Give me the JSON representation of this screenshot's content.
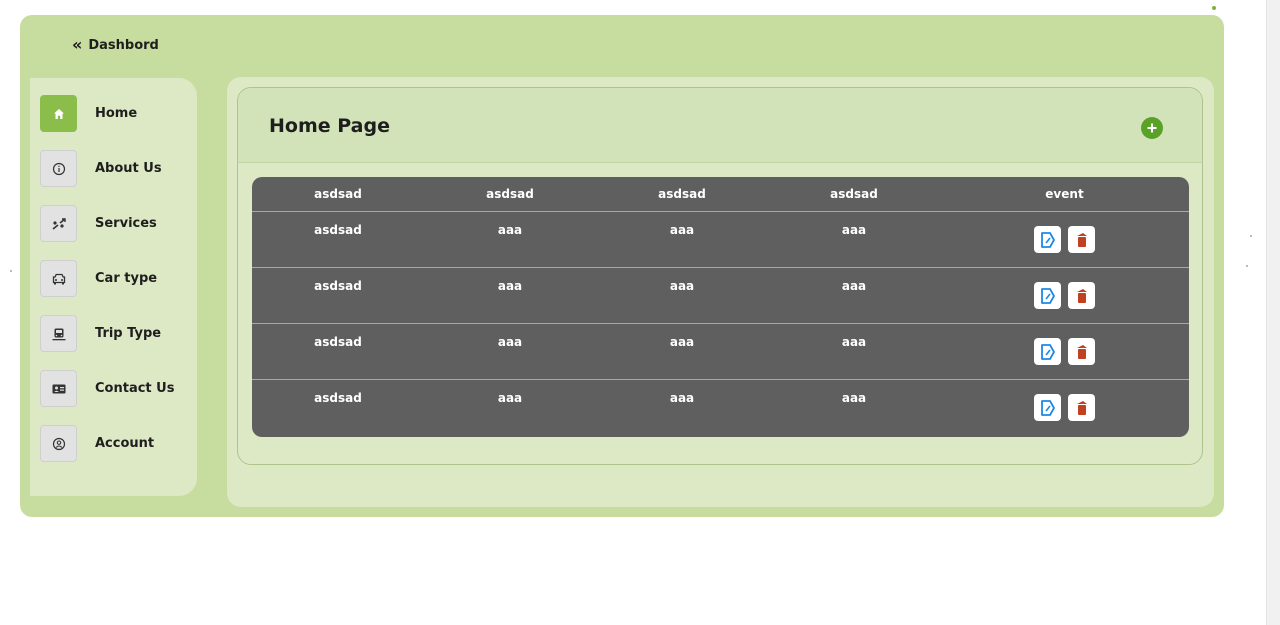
{
  "app": {
    "title": "Dashbord",
    "collapse_icon": "chevron-double-left-icon"
  },
  "sidebar": {
    "items": [
      {
        "label": "Home",
        "icon": "home-icon",
        "active": true
      },
      {
        "label": "About Us",
        "icon": "info-icon",
        "active": false
      },
      {
        "label": "Services",
        "icon": "services-icon",
        "active": false
      },
      {
        "label": "Car type",
        "icon": "car-icon",
        "active": false
      },
      {
        "label": "Trip Type",
        "icon": "bus-icon",
        "active": false
      },
      {
        "label": "Contact Us",
        "icon": "contact-card-icon",
        "active": false
      },
      {
        "label": "Account",
        "icon": "user-circle-icon",
        "active": false
      }
    ]
  },
  "main": {
    "page_title": "Home Page",
    "add_icon": "plus-circle-icon",
    "table": {
      "headers": [
        "asdsad",
        "asdsad",
        "asdsad",
        "asdsad",
        "event"
      ],
      "rows": [
        [
          "asdsad",
          "aaa",
          "aaa",
          "aaa"
        ],
        [
          "asdsad",
          "aaa",
          "aaa",
          "aaa"
        ],
        [
          "asdsad",
          "aaa",
          "aaa",
          "aaa"
        ],
        [
          "asdsad",
          "aaa",
          "aaa",
          "aaa"
        ]
      ],
      "row_actions": [
        "edit-icon",
        "delete-icon"
      ]
    }
  },
  "colors": {
    "frame": "#c7dd9f",
    "panel": "#dde9c5",
    "accent": "#8bbd4a",
    "add_button": "#5aa227",
    "table_bg": "#5f5f5f",
    "edit": "#1e88e5",
    "delete": "#c0401f"
  }
}
